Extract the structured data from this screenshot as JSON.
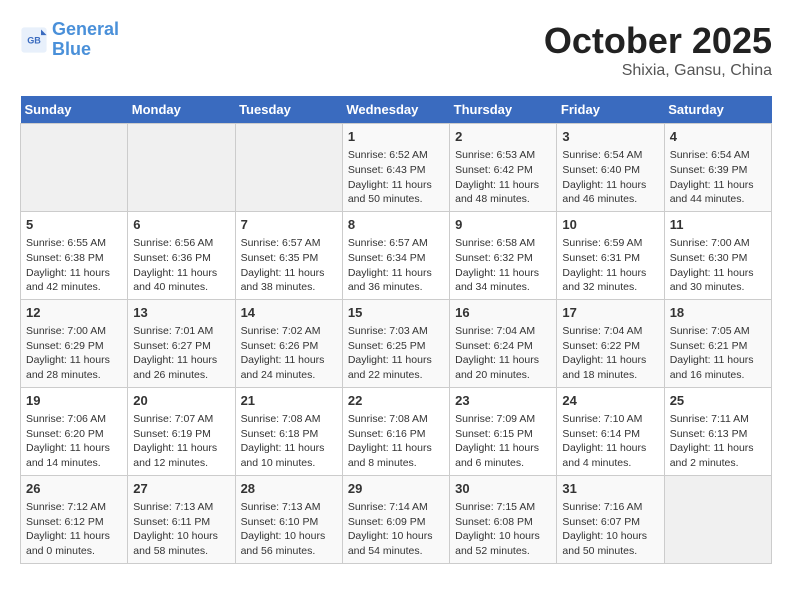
{
  "logo": {
    "line1": "General",
    "line2": "Blue"
  },
  "title": "October 2025",
  "subtitle": "Shixia, Gansu, China",
  "headers": [
    "Sunday",
    "Monday",
    "Tuesday",
    "Wednesday",
    "Thursday",
    "Friday",
    "Saturday"
  ],
  "weeks": [
    [
      {
        "num": "",
        "info": ""
      },
      {
        "num": "",
        "info": ""
      },
      {
        "num": "",
        "info": ""
      },
      {
        "num": "1",
        "info": "Sunrise: 6:52 AM\nSunset: 6:43 PM\nDaylight: 11 hours and 50 minutes."
      },
      {
        "num": "2",
        "info": "Sunrise: 6:53 AM\nSunset: 6:42 PM\nDaylight: 11 hours and 48 minutes."
      },
      {
        "num": "3",
        "info": "Sunrise: 6:54 AM\nSunset: 6:40 PM\nDaylight: 11 hours and 46 minutes."
      },
      {
        "num": "4",
        "info": "Sunrise: 6:54 AM\nSunset: 6:39 PM\nDaylight: 11 hours and 44 minutes."
      }
    ],
    [
      {
        "num": "5",
        "info": "Sunrise: 6:55 AM\nSunset: 6:38 PM\nDaylight: 11 hours and 42 minutes."
      },
      {
        "num": "6",
        "info": "Sunrise: 6:56 AM\nSunset: 6:36 PM\nDaylight: 11 hours and 40 minutes."
      },
      {
        "num": "7",
        "info": "Sunrise: 6:57 AM\nSunset: 6:35 PM\nDaylight: 11 hours and 38 minutes."
      },
      {
        "num": "8",
        "info": "Sunrise: 6:57 AM\nSunset: 6:34 PM\nDaylight: 11 hours and 36 minutes."
      },
      {
        "num": "9",
        "info": "Sunrise: 6:58 AM\nSunset: 6:32 PM\nDaylight: 11 hours and 34 minutes."
      },
      {
        "num": "10",
        "info": "Sunrise: 6:59 AM\nSunset: 6:31 PM\nDaylight: 11 hours and 32 minutes."
      },
      {
        "num": "11",
        "info": "Sunrise: 7:00 AM\nSunset: 6:30 PM\nDaylight: 11 hours and 30 minutes."
      }
    ],
    [
      {
        "num": "12",
        "info": "Sunrise: 7:00 AM\nSunset: 6:29 PM\nDaylight: 11 hours and 28 minutes."
      },
      {
        "num": "13",
        "info": "Sunrise: 7:01 AM\nSunset: 6:27 PM\nDaylight: 11 hours and 26 minutes."
      },
      {
        "num": "14",
        "info": "Sunrise: 7:02 AM\nSunset: 6:26 PM\nDaylight: 11 hours and 24 minutes."
      },
      {
        "num": "15",
        "info": "Sunrise: 7:03 AM\nSunset: 6:25 PM\nDaylight: 11 hours and 22 minutes."
      },
      {
        "num": "16",
        "info": "Sunrise: 7:04 AM\nSunset: 6:24 PM\nDaylight: 11 hours and 20 minutes."
      },
      {
        "num": "17",
        "info": "Sunrise: 7:04 AM\nSunset: 6:22 PM\nDaylight: 11 hours and 18 minutes."
      },
      {
        "num": "18",
        "info": "Sunrise: 7:05 AM\nSunset: 6:21 PM\nDaylight: 11 hours and 16 minutes."
      }
    ],
    [
      {
        "num": "19",
        "info": "Sunrise: 7:06 AM\nSunset: 6:20 PM\nDaylight: 11 hours and 14 minutes."
      },
      {
        "num": "20",
        "info": "Sunrise: 7:07 AM\nSunset: 6:19 PM\nDaylight: 11 hours and 12 minutes."
      },
      {
        "num": "21",
        "info": "Sunrise: 7:08 AM\nSunset: 6:18 PM\nDaylight: 11 hours and 10 minutes."
      },
      {
        "num": "22",
        "info": "Sunrise: 7:08 AM\nSunset: 6:16 PM\nDaylight: 11 hours and 8 minutes."
      },
      {
        "num": "23",
        "info": "Sunrise: 7:09 AM\nSunset: 6:15 PM\nDaylight: 11 hours and 6 minutes."
      },
      {
        "num": "24",
        "info": "Sunrise: 7:10 AM\nSunset: 6:14 PM\nDaylight: 11 hours and 4 minutes."
      },
      {
        "num": "25",
        "info": "Sunrise: 7:11 AM\nSunset: 6:13 PM\nDaylight: 11 hours and 2 minutes."
      }
    ],
    [
      {
        "num": "26",
        "info": "Sunrise: 7:12 AM\nSunset: 6:12 PM\nDaylight: 11 hours and 0 minutes."
      },
      {
        "num": "27",
        "info": "Sunrise: 7:13 AM\nSunset: 6:11 PM\nDaylight: 10 hours and 58 minutes."
      },
      {
        "num": "28",
        "info": "Sunrise: 7:13 AM\nSunset: 6:10 PM\nDaylight: 10 hours and 56 minutes."
      },
      {
        "num": "29",
        "info": "Sunrise: 7:14 AM\nSunset: 6:09 PM\nDaylight: 10 hours and 54 minutes."
      },
      {
        "num": "30",
        "info": "Sunrise: 7:15 AM\nSunset: 6:08 PM\nDaylight: 10 hours and 52 minutes."
      },
      {
        "num": "31",
        "info": "Sunrise: 7:16 AM\nSunset: 6:07 PM\nDaylight: 10 hours and 50 minutes."
      },
      {
        "num": "",
        "info": ""
      }
    ]
  ]
}
